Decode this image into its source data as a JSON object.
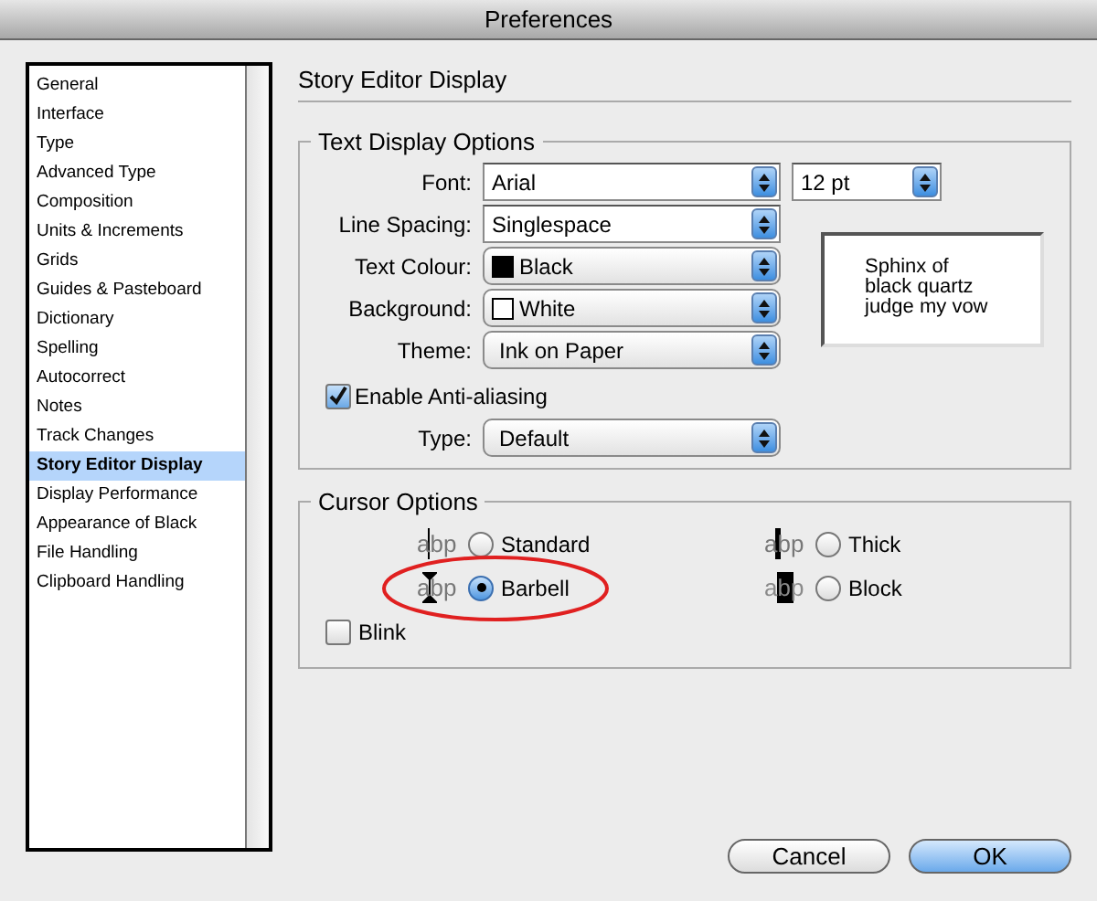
{
  "window": {
    "title": "Preferences"
  },
  "sidebar": {
    "items": [
      {
        "label": "General",
        "selected": false
      },
      {
        "label": "Interface",
        "selected": false
      },
      {
        "label": "Type",
        "selected": false
      },
      {
        "label": "Advanced Type",
        "selected": false
      },
      {
        "label": "Composition",
        "selected": false
      },
      {
        "label": "Units & Increments",
        "selected": false
      },
      {
        "label": "Grids",
        "selected": false
      },
      {
        "label": "Guides & Pasteboard",
        "selected": false
      },
      {
        "label": "Dictionary",
        "selected": false
      },
      {
        "label": "Spelling",
        "selected": false
      },
      {
        "label": "Autocorrect",
        "selected": false
      },
      {
        "label": "Notes",
        "selected": false
      },
      {
        "label": "Track Changes",
        "selected": false
      },
      {
        "label": "Story Editor Display",
        "selected": true
      },
      {
        "label": "Display Performance",
        "selected": false
      },
      {
        "label": "Appearance of Black",
        "selected": false
      },
      {
        "label": "File Handling",
        "selected": false
      },
      {
        "label": "Clipboard Handling",
        "selected": false
      }
    ]
  },
  "panel_title": "Story Editor Display",
  "text_display_options": {
    "title": "Text Display Options",
    "fields": [
      {
        "label": "Font:",
        "value": "Arial",
        "kind": "combo",
        "size_value": "12 pt"
      },
      {
        "label": "Line Spacing:",
        "value": "Singlespace",
        "kind": "combo"
      },
      {
        "label": "Text Colour:",
        "value": "Black",
        "kind": "popup",
        "color": "#000000"
      },
      {
        "label": "Background:",
        "value": "White",
        "kind": "popup",
        "color": "#ffffff"
      },
      {
        "label": "Theme:",
        "value": "Ink on Paper",
        "kind": "popup"
      }
    ],
    "preview_text": "Sphinx of black quartz judge my vow",
    "anti_aliasing": {
      "label": "Enable Anti-aliasing",
      "checked": true
    },
    "type": {
      "label": "Type:",
      "value": "Default"
    }
  },
  "cursor_options": {
    "title": "Cursor Options",
    "options": [
      {
        "kind": "standard",
        "preview": "abp",
        "label": "Standard",
        "selected": false,
        "circled": false
      },
      {
        "kind": "thick",
        "preview": "abp",
        "label": "Thick",
        "selected": false,
        "circled": false
      },
      {
        "kind": "barbell",
        "preview": "abp",
        "label": "Barbell",
        "selected": true,
        "circled": true
      },
      {
        "kind": "block",
        "preview": "abp",
        "label": "Block",
        "selected": false,
        "circled": false
      }
    ],
    "blink": {
      "label": "Blink",
      "checked": false
    }
  },
  "buttons": [
    {
      "label": "Cancel",
      "default": false
    },
    {
      "label": "OK",
      "default": true
    }
  ]
}
